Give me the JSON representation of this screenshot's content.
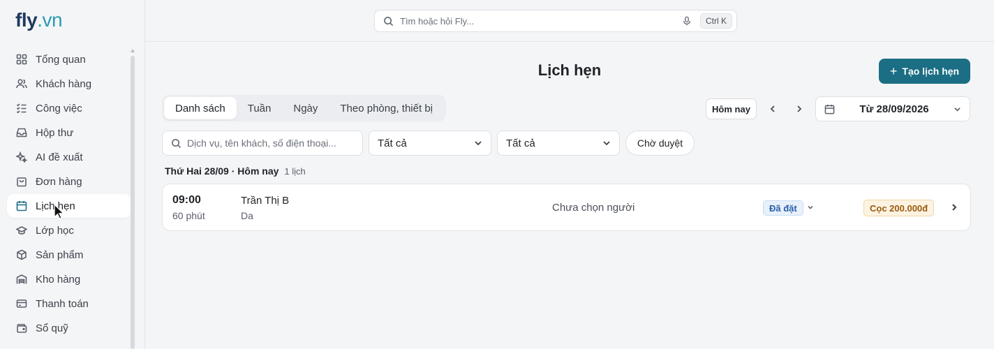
{
  "brand": {
    "part1": "fly",
    "part2": ".vn"
  },
  "search": {
    "placeholder": "Tìm hoặc hỏi Fly...",
    "shortcut": "Ctrl K"
  },
  "sidebar": {
    "items": [
      {
        "label": "Tổng quan",
        "icon": "grid-icon"
      },
      {
        "label": "Khách hàng",
        "icon": "users-icon"
      },
      {
        "label": "Công việc",
        "icon": "tasks-icon"
      },
      {
        "label": "Hộp thư",
        "icon": "inbox-icon"
      },
      {
        "label": "AI đề xuất",
        "icon": "sparkles-icon"
      },
      {
        "label": "Đơn hàng",
        "icon": "shopping-bag-icon"
      },
      {
        "label": "Lịch hẹn",
        "icon": "calendar-icon",
        "active": true
      },
      {
        "label": "Lớp học",
        "icon": "graduation-cap-icon"
      },
      {
        "label": "Sản phẩm",
        "icon": "package-icon"
      },
      {
        "label": "Kho hàng",
        "icon": "warehouse-icon"
      },
      {
        "label": "Thanh toán",
        "icon": "credit-card-icon"
      },
      {
        "label": "Sổ quỹ",
        "icon": "wallet-icon"
      }
    ]
  },
  "page": {
    "title": "Lịch hẹn",
    "create_label": "Tạo lịch hẹn",
    "tabs": [
      "Danh sách",
      "Tuần",
      "Ngày",
      "Theo phòng, thiết bị"
    ],
    "active_tab": 0,
    "today_label": "Hôm nay",
    "date_range": "Từ 28/09/2026"
  },
  "filters": {
    "search_placeholder": "Dịch vụ, tên khách, số điện thoại...",
    "select1": "Tất cả",
    "select2": "Tất cả",
    "pending_label": "Chờ duyệt"
  },
  "day_group": {
    "label": "Thứ Hai 28/09 · Hôm nay",
    "count": "1 lịch"
  },
  "appointment": {
    "time": "09:00",
    "duration": "60 phút",
    "customer": "Trần Thị B",
    "service": "Da",
    "staff": "Chưa chọn người",
    "status": "Đã đặt",
    "deposit": "Cọc 200.000đ"
  },
  "colors": {
    "accent": "#1b6e84",
    "brand_dark": "#1e3a5f",
    "brand_light": "#2b9ab3"
  }
}
